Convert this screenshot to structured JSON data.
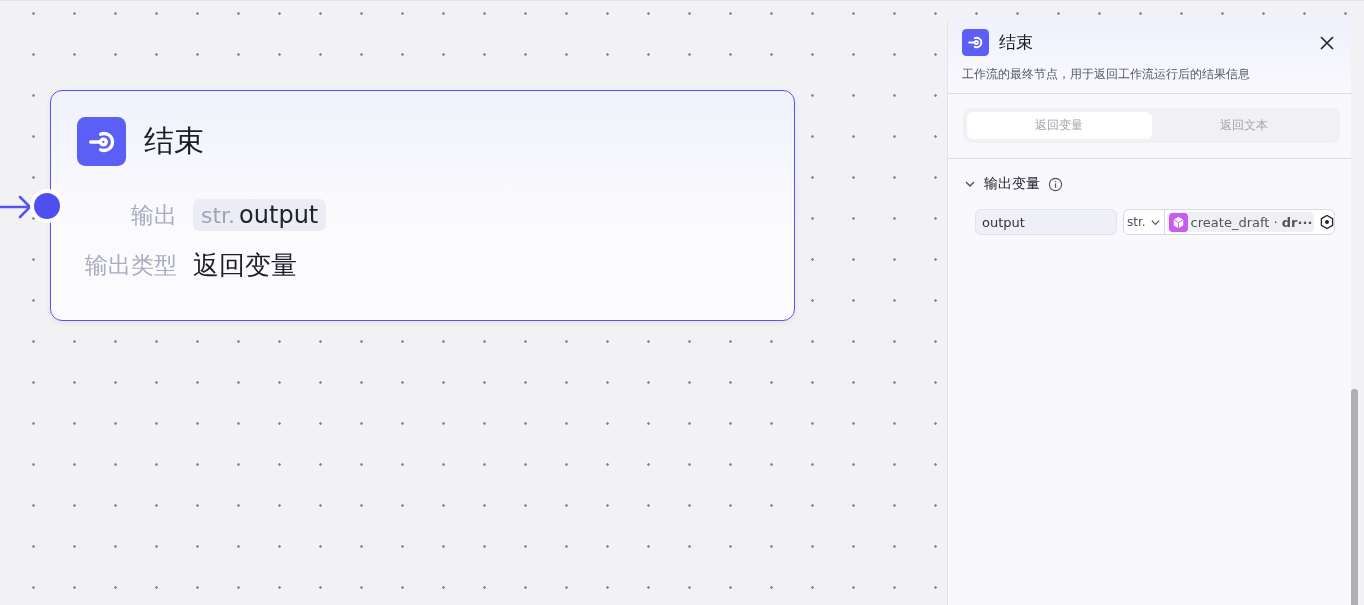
{
  "node": {
    "title": "结束",
    "selected": true,
    "fields": [
      {
        "kind": "variable",
        "label": "输出",
        "type": "str.",
        "value": "output"
      },
      {
        "kind": "text",
        "label": "输出类型",
        "value": "返回变量"
      }
    ]
  },
  "panel": {
    "title": "结束",
    "description": "工作流的最终节点，用于返回工作流运行后的结果信息",
    "tabs": [
      {
        "label": "返回变量",
        "selected": true,
        "disabled": true
      },
      {
        "label": "返回文本",
        "selected": false,
        "disabled": true
      }
    ],
    "section": {
      "title": "输出变量",
      "expanded": true,
      "rows": [
        {
          "name": "output",
          "type": "str.",
          "source": "create_draft",
          "path": "· **dr···**"
        }
      ]
    }
  }
}
